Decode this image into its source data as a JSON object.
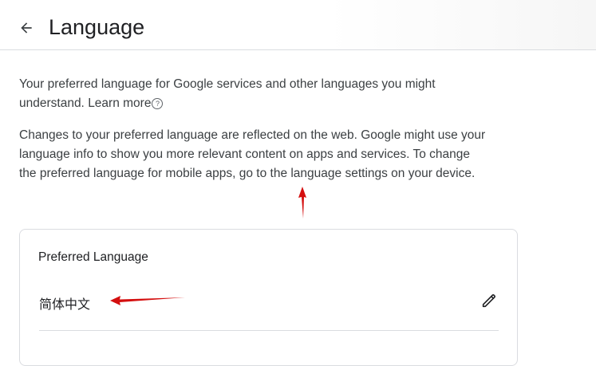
{
  "header": {
    "title": "Language",
    "back_icon": "arrow-left-icon"
  },
  "intro": {
    "text": "Your preferred language for Google services and other languages you might understand.",
    "learn_more": "Learn more",
    "help_icon": "help-circle-icon",
    "help_glyph": "?"
  },
  "info": {
    "text": "Changes to your preferred language are reflected on the web. Google might use your language info to show you more relevant content on apps and services. To change the preferred language for mobile apps, go to the language settings on your device."
  },
  "preferred_card": {
    "title": "Preferred Language",
    "value": "简体中文",
    "edit_icon": "pencil-icon"
  },
  "annotations": {
    "arrow_color": "#d40f0f"
  },
  "colors": {
    "text_primary": "#202124",
    "text_secondary": "#3c4043",
    "border": "#dadce0"
  }
}
